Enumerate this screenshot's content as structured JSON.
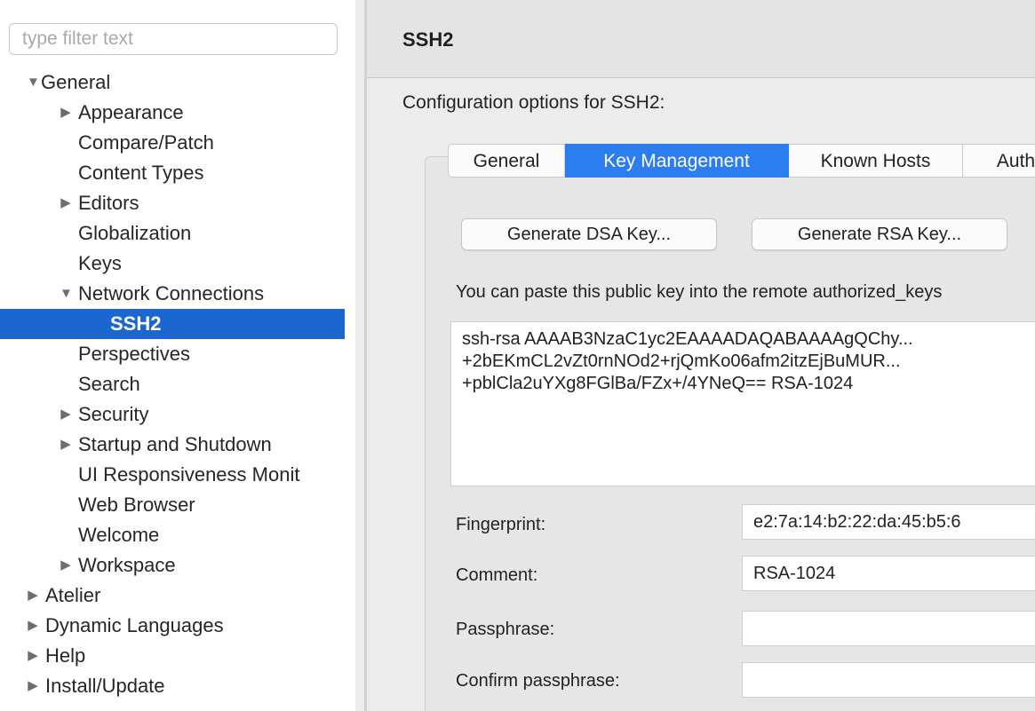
{
  "filter": {
    "placeholder": "type filter text"
  },
  "tree": {
    "items": [
      {
        "label": "General",
        "toggle": "▼"
      },
      {
        "label": "Appearance",
        "toggle": "▶"
      },
      {
        "label": "Compare/Patch",
        "toggle": ""
      },
      {
        "label": "Content Types",
        "toggle": ""
      },
      {
        "label": "Editors",
        "toggle": "▶"
      },
      {
        "label": "Globalization",
        "toggle": ""
      },
      {
        "label": "Keys",
        "toggle": ""
      },
      {
        "label": "Network Connections",
        "toggle": "▼"
      },
      {
        "label": "SSH2",
        "toggle": ""
      },
      {
        "label": "Perspectives",
        "toggle": ""
      },
      {
        "label": "Search",
        "toggle": ""
      },
      {
        "label": "Security",
        "toggle": "▶"
      },
      {
        "label": "Startup and Shutdown",
        "toggle": "▶"
      },
      {
        "label": "UI Responsiveness Monit",
        "toggle": ""
      },
      {
        "label": "Web Browser",
        "toggle": ""
      },
      {
        "label": "Welcome",
        "toggle": ""
      },
      {
        "label": "Workspace",
        "toggle": "▶"
      },
      {
        "label": "Atelier",
        "toggle": "▶"
      },
      {
        "label": "Dynamic Languages",
        "toggle": "▶"
      },
      {
        "label": "Help",
        "toggle": "▶"
      },
      {
        "label": "Install/Update",
        "toggle": "▶"
      }
    ]
  },
  "page": {
    "title": "SSH2",
    "description": "Configuration options for SSH2:"
  },
  "tabs": [
    "General",
    "Key Management",
    "Known Hosts",
    "Auth"
  ],
  "key_management": {
    "generate_dsa": "Generate DSA Key...",
    "generate_rsa": "Generate RSA Key...",
    "paste_hint": "You can paste this public key into the remote authorized_keys",
    "public_key_lines": [
      "ssh-rsa AAAAB3NzaC1yc2EAAAADAQABAAAAgQChy...",
      "+2bEKmCL2vZt0rnNOd2+rjQmKo06afm2itzEjBuMUR...",
      "+pblCla2uYXg8FGlBa/FZx+/4YNeQ== RSA-1024"
    ],
    "fingerprint_label": "Fingerprint:",
    "fingerprint_value": "e2:7a:14:b2:22:da:45:b5:6",
    "comment_label": "Comment:",
    "comment_value": "RSA-1024",
    "passphrase_label": "Passphrase:",
    "passphrase_value": "",
    "confirm_label": "Confirm passphrase:",
    "confirm_value": ""
  },
  "colors": {
    "selection": "#1c66cf",
    "active_tab": "#2c7ef0"
  }
}
